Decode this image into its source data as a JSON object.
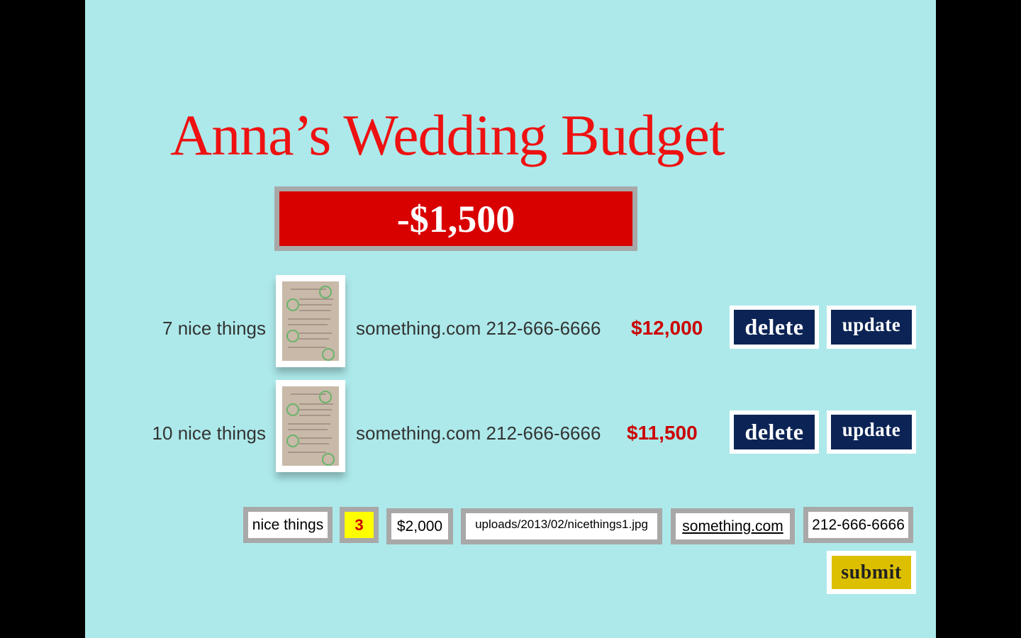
{
  "header": {
    "title": "Anna’s Wedding Budget",
    "total": "-$1,500"
  },
  "items": [
    {
      "quantity": "7 nice things",
      "vendor": "something.com 212-666-6666",
      "cost": "$12,000",
      "delete_label": "delete",
      "update_label": "update"
    },
    {
      "quantity": "10 nice things",
      "vendor": "something.com 212-666-6666",
      "cost": "$11,500",
      "delete_label": "delete",
      "update_label": "update"
    }
  ],
  "form": {
    "name": "nice things",
    "quantity": "3",
    "cost": "$2,000",
    "image_path": "uploads/2013/02/nicethings1.jpg",
    "website": "something.com",
    "phone": "212-666-6666",
    "submit_label": "submit"
  },
  "colors": {
    "background": "#ade9ea",
    "title": "#ee1111",
    "total_box": "#d90000",
    "button": "#0c2455",
    "submit": "#dcc000",
    "cost": "#cc0000",
    "quantity_highlight": "#ffff00"
  }
}
